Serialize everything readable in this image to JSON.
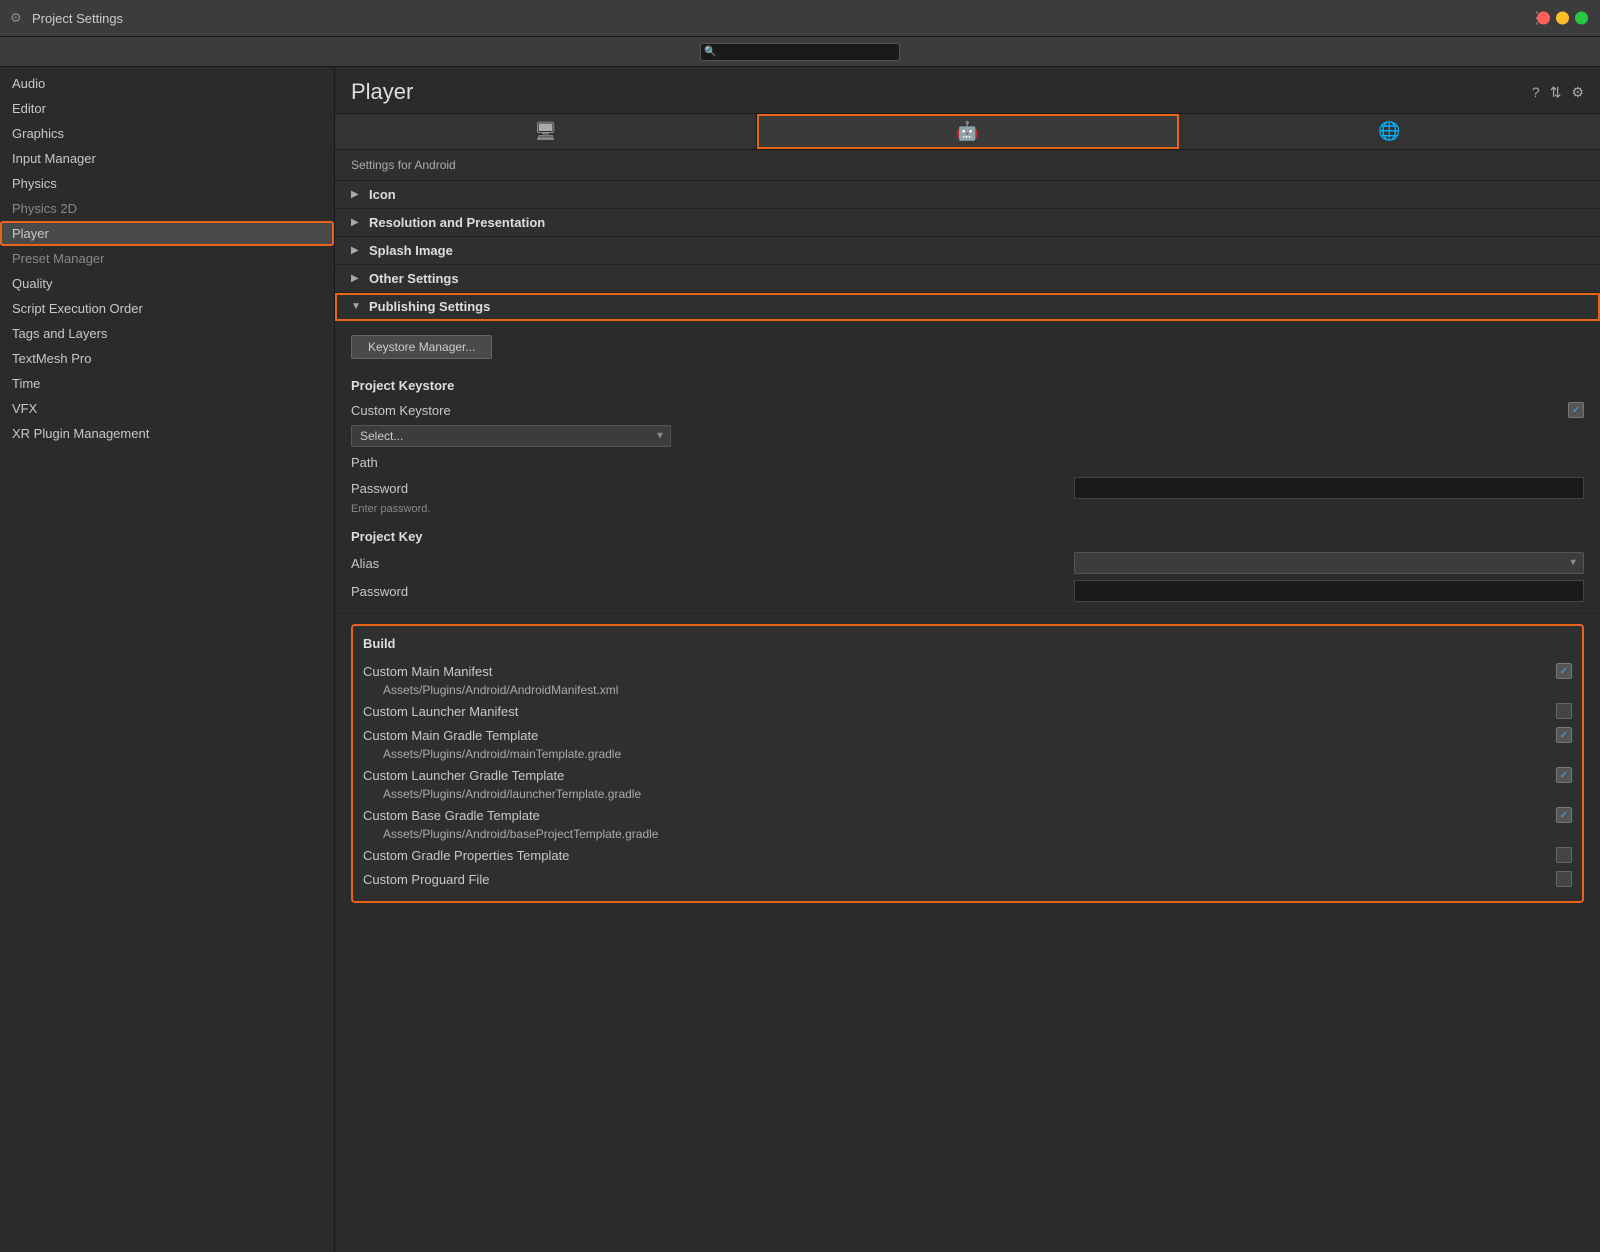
{
  "titlebar": {
    "title": "Project Settings",
    "icon": "⚙"
  },
  "search": {
    "placeholder": ""
  },
  "sidebar": {
    "items": [
      {
        "id": "audio",
        "label": "Audio",
        "active": false
      },
      {
        "id": "editor",
        "label": "Editor",
        "active": false
      },
      {
        "id": "graphics",
        "label": "Graphics",
        "active": false
      },
      {
        "id": "input-manager",
        "label": "Input Manager",
        "active": false
      },
      {
        "id": "physics",
        "label": "Physics",
        "active": false
      },
      {
        "id": "physics-2d",
        "label": "Physics 2D",
        "active": false,
        "dimmed": true
      },
      {
        "id": "player",
        "label": "Player",
        "active": true
      },
      {
        "id": "preset-manager",
        "label": "Preset Manager",
        "active": false,
        "dimmed": true
      },
      {
        "id": "quality",
        "label": "Quality",
        "active": false
      },
      {
        "id": "script-execution-order",
        "label": "Script Execution Order",
        "active": false
      },
      {
        "id": "tags-and-layers",
        "label": "Tags and Layers",
        "active": false
      },
      {
        "id": "textmesh-pro",
        "label": "TextMesh Pro",
        "active": false
      },
      {
        "id": "time",
        "label": "Time",
        "active": false
      },
      {
        "id": "vfx",
        "label": "VFX",
        "active": false
      },
      {
        "id": "xr-plugin-management",
        "label": "XR Plugin Management",
        "active": false
      }
    ]
  },
  "player": {
    "title": "Player",
    "settings_for": "Settings for Android",
    "tabs": [
      {
        "id": "desktop",
        "icon": "🖥",
        "active": false
      },
      {
        "id": "android",
        "icon": "🤖",
        "active": true
      },
      {
        "id": "webgl",
        "icon": "🌐",
        "active": false
      }
    ],
    "sections": {
      "icon": {
        "label": "Icon",
        "expanded": false
      },
      "resolution": {
        "label": "Resolution and Presentation",
        "expanded": false
      },
      "splash": {
        "label": "Splash Image",
        "expanded": false
      },
      "other": {
        "label": "Other Settings",
        "expanded": false
      },
      "publishing": {
        "label": "Publishing Settings",
        "expanded": true,
        "highlighted": true
      }
    },
    "publishing": {
      "keystore_btn": "Keystore Manager...",
      "project_keystore_label": "Project Keystore",
      "custom_keystore_label": "Custom Keystore",
      "select_placeholder": "Select...",
      "path_label": "Path",
      "password_label": "Password",
      "enter_password_hint": "Enter password.",
      "project_key_label": "Project Key",
      "alias_label": "Alias",
      "password2_label": "Password"
    },
    "build": {
      "title": "Build",
      "custom_main_manifest_label": "Custom Main Manifest",
      "custom_main_manifest_checked": true,
      "custom_main_manifest_path": "Assets/Plugins/Android/AndroidManifest.xml",
      "custom_launcher_manifest_label": "Custom Launcher Manifest",
      "custom_launcher_manifest_checked": false,
      "custom_main_gradle_label": "Custom Main Gradle Template",
      "custom_main_gradle_checked": true,
      "custom_main_gradle_path": "Assets/Plugins/Android/mainTemplate.gradle",
      "custom_launcher_gradle_label": "Custom Launcher Gradle Template",
      "custom_launcher_gradle_checked": true,
      "custom_launcher_gradle_path": "Assets/Plugins/Android/launcherTemplate.gradle",
      "custom_base_gradle_label": "Custom Base Gradle Template",
      "custom_base_gradle_checked": true,
      "custom_base_gradle_path": "Assets/Plugins/Android/baseProjectTemplate.gradle",
      "custom_gradle_props_label": "Custom Gradle Properties Template",
      "custom_gradle_props_checked": false,
      "custom_proguard_label": "Custom Proguard File",
      "custom_proguard_checked": false
    }
  },
  "header_icons": {
    "help": "?",
    "layout": "⇅",
    "settings": "⚙"
  }
}
